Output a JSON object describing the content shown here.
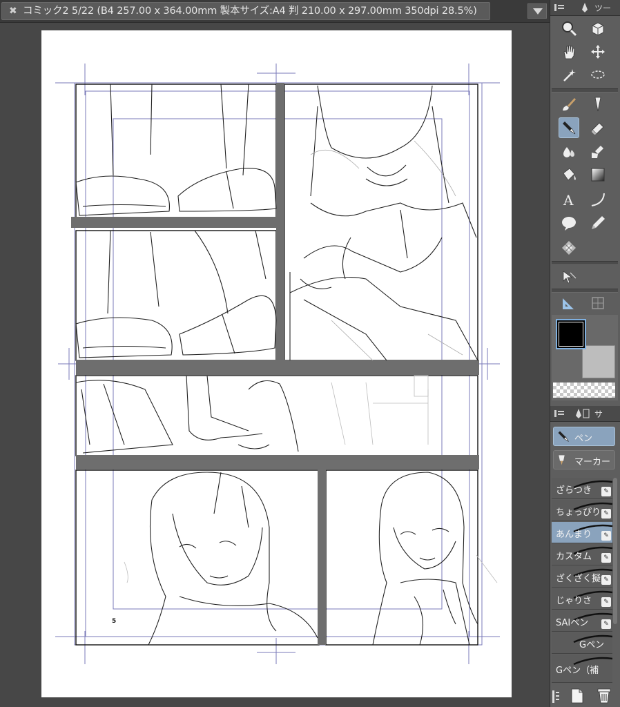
{
  "document_tab": {
    "close_glyph": "✖",
    "title": "コミック2 5/22 (B4 257.00 x 364.00mm 製本サイズ:A4 判 210.00 x 297.00mm 350dpi 28.5%)"
  },
  "page": {
    "page_number": "5"
  },
  "tool_palette": {
    "header_label": "ツー",
    "selected_tool": "pen-tool",
    "tools": [
      "zoom-icon",
      "object-select-icon",
      "hand-icon",
      "move-layer-icon",
      "magic-wand-icon",
      "lasso-icon",
      "brush-icon",
      "dropper-icon",
      "pen-icon",
      "eraser-icon",
      "fill-icon",
      "ink-blend-icon",
      "bucket-icon",
      "gradient-icon",
      "text-icon",
      "curve-icon",
      "balloon-icon",
      "pencil-icon",
      "decoration-icon",
      "ruler-select-icon",
      "triangle-ruler-icon",
      "frame-ruler-icon"
    ]
  },
  "colors": {
    "main": "#000000",
    "sub": "#bdbdbd",
    "accent": "#8aa3bd"
  },
  "sub_tool_palette": {
    "header_label": "サ",
    "groups": [
      {
        "label": "ペン",
        "selected": true
      },
      {
        "label": "マーカー",
        "selected": false
      }
    ],
    "brushes": [
      {
        "label": "ざらつき",
        "selected": false
      },
      {
        "label": "ちょっぴり",
        "selected": false
      },
      {
        "label": "あんまり",
        "selected": true
      },
      {
        "label": "カスタム",
        "selected": false
      },
      {
        "label": "ざくざく擬",
        "selected": false
      },
      {
        "label": "じゃりさ",
        "selected": false
      },
      {
        "label": "SAIペン",
        "selected": false
      },
      {
        "label": "Gペン",
        "selected": false
      },
      {
        "label": "Gペン（補",
        "selected": false
      }
    ]
  }
}
